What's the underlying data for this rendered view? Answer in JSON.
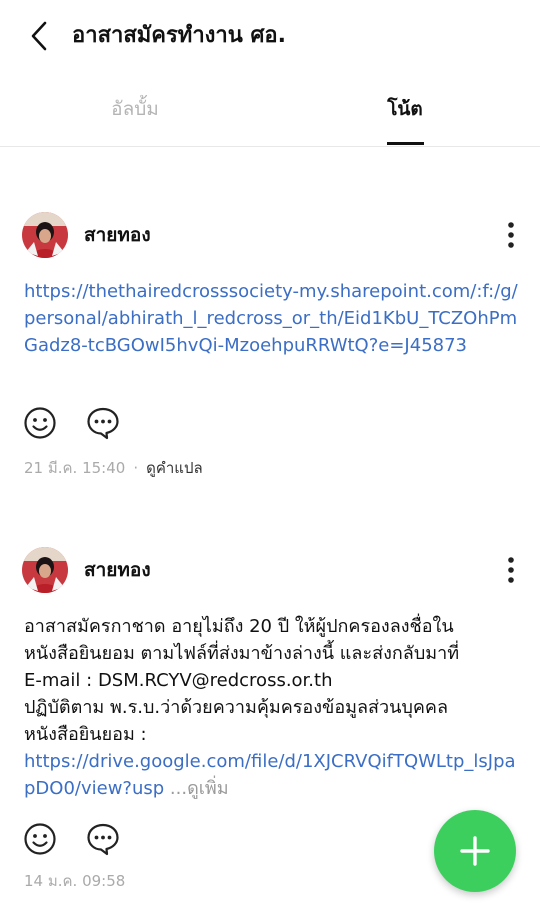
{
  "header": {
    "title": "อาสาสมัครทำงาน ศอ.",
    "back_icon": "chevron-left-icon"
  },
  "tabs": [
    {
      "label": "อัลบั้ม",
      "active": false
    },
    {
      "label": "โน้ต",
      "active": true
    }
  ],
  "posts": [
    {
      "author": "สายทอง",
      "body_lines": [],
      "link": "https://thethairedcrosssociety-my.sharepoint.com/:f:/g/personal/abhirath_l_redcross_or_th/Eid1KbU_TCZOhPmGadz8-tcBGOwI5hvQi-MzoehpuRRWtQ?e=J45873",
      "time": "21 มี.ค. 15:40",
      "translate_label": "ดูคำแปล"
    },
    {
      "author": "สายทอง",
      "body_lines": [
        "อาสาสมัครกาชาด อายุไม่ถึง 20 ปี ให้ผู้ปกครองลงชื่อใน",
        "หนังสือยินยอม ตามไฟล์ที่ส่งมาข้างล่างนี้ และส่งกลับมาที่",
        "E-mail : DSM.RCYV@redcross.or.th",
        "ปฏิบัติตาม พ.ร.บ.ว่าด้วยความคุ้มครองข้อมูลส่วนบุคคล",
        "หนังสือยินยอม :"
      ],
      "link": "https://drive.google.com/file/d/1XJCRVQifTQWLtp_lsJpapDO0/view?usp",
      "see_more_label": "...ดูเพิ่ม",
      "time": "14 ม.ค. 09:58"
    }
  ],
  "icons": {
    "more": "more-vertical-icon",
    "emoji": "smiley-icon",
    "comment": "comment-bubble-icon",
    "add": "plus-icon"
  },
  "colors": {
    "link": "#3b6ec4",
    "fab": "#3ccf5e",
    "inactive_tab": "#b4b4b4",
    "meta": "#aaaaaa"
  }
}
